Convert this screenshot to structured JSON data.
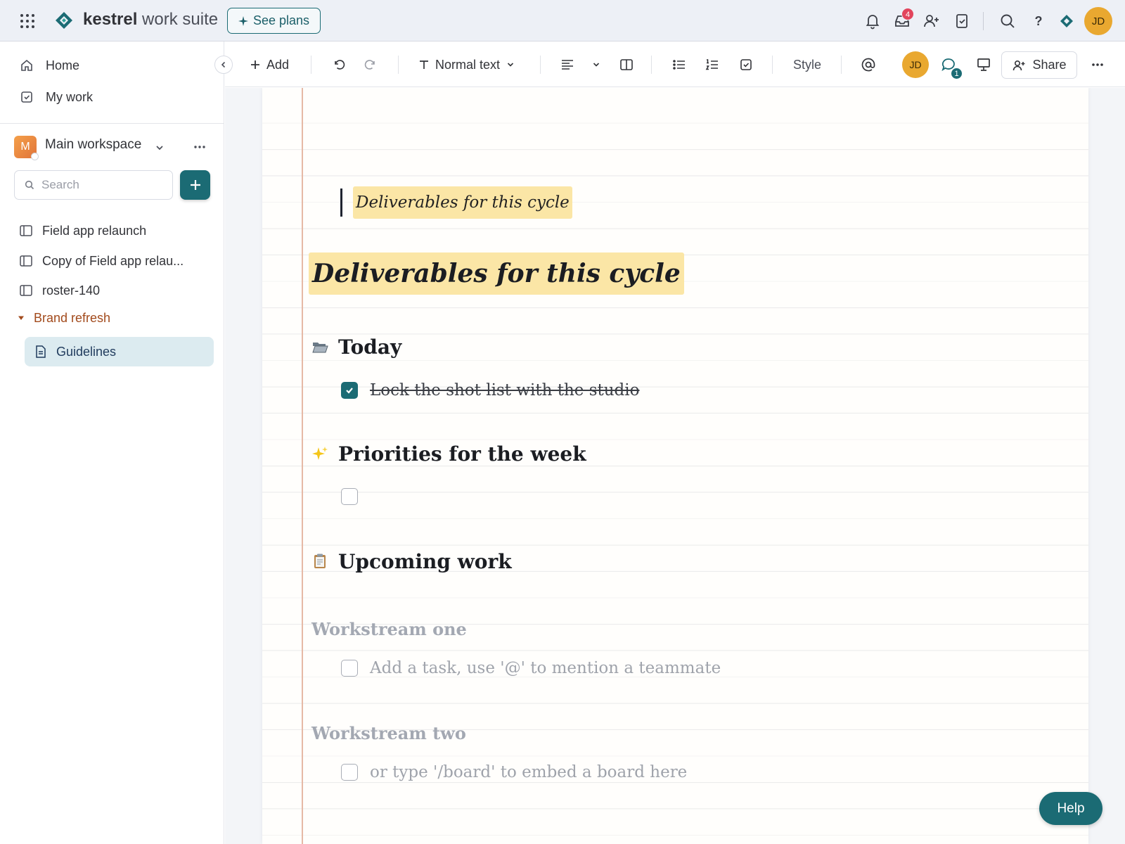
{
  "header": {
    "brand_bold": "kestrel",
    "brand_light": " work suite",
    "see_plans_label": "See plans",
    "inbox_badge": "4",
    "help_label": "?",
    "user_initials": "JD"
  },
  "sidebar": {
    "nav": [
      {
        "label": "Home",
        "icon": "home-icon"
      },
      {
        "label": "My work",
        "icon": "check-square-icon"
      }
    ],
    "workspace": {
      "badge": "M",
      "name": "Main workspace"
    },
    "search": {
      "placeholder": "Search",
      "value": ""
    },
    "boards": [
      {
        "label": "Field app relaunch"
      },
      {
        "label": "Copy of Field app relau..."
      },
      {
        "label": "roster-140"
      }
    ],
    "folder": {
      "label": "Brand refresh",
      "expanded": true
    },
    "active_doc": {
      "label": "Guidelines"
    }
  },
  "toolbar": {
    "add_label": "Add",
    "text_style_label": "Normal text",
    "style_label": "Style",
    "user_initials": "JD",
    "comment_badge": "1",
    "share_label": "Share"
  },
  "document": {
    "highlight_small": "Deliverables for this cycle",
    "title": "Deliverables for this cycle",
    "sections": [
      {
        "emoji": "folder-open-icon",
        "heading": "Today"
      },
      {
        "emoji": "sparkles-icon",
        "heading": "Priorities for the week"
      },
      {
        "emoji": "clipboard-icon",
        "heading": "Upcoming work"
      }
    ],
    "tasks": {
      "today_item": {
        "text": "Lock the shot list with the studio",
        "checked": true
      },
      "priorities_item": {
        "text": "",
        "checked": false
      }
    },
    "workstreams": [
      {
        "heading": "Workstream one",
        "placeholder": "Add a task, use '@' to mention a teammate"
      },
      {
        "heading": "Workstream two",
        "placeholder": "or type '/board' to embed a board here"
      }
    ]
  },
  "help_button_label": "Help",
  "colors": {
    "accent": "#1b6b74",
    "highlight": "#fbe6a6",
    "folder": "#a24a1c",
    "avatar": "#e9a830",
    "badge": "#e2445c"
  }
}
